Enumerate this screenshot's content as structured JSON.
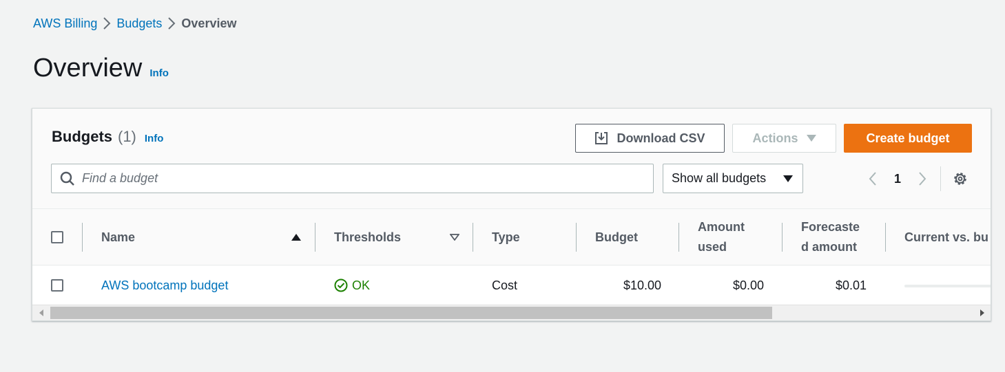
{
  "breadcrumb": {
    "items": [
      {
        "label": "AWS Billing"
      },
      {
        "label": "Budgets"
      },
      {
        "label": "Overview"
      }
    ]
  },
  "page": {
    "title": "Overview",
    "info_label": "Info"
  },
  "budgets_panel": {
    "title": "Budgets",
    "count": "(1)",
    "info_label": "Info",
    "download_csv_label": "Download CSV",
    "actions_label": "Actions",
    "create_budget_label": "Create budget",
    "search_placeholder": "Find a budget",
    "filter_selected": "Show all budgets",
    "current_page": "1"
  },
  "table": {
    "columns": {
      "name": "Name",
      "thresholds": "Thresholds",
      "type": "Type",
      "budget": "Budget",
      "amount_used_line1": "Amount",
      "amount_used_line2": "used",
      "forecasted_line1": "Forecaste",
      "forecasted_line2": "d amount",
      "current_vs_budgeted": "Current vs. bu"
    },
    "rows": [
      {
        "name": "AWS bootcamp budget",
        "thresholds": "OK",
        "type": "Cost",
        "budget": "$10.00",
        "amount_used": "$0.00",
        "forecasted_amount": "$0.01",
        "current_vs_budgeted_fraction": 0
      }
    ]
  },
  "icons": {
    "breadcrumb_separator": "chevron-right-icon",
    "download": "download-icon",
    "actions_caret": "caret-down-icon",
    "search": "search-icon",
    "filter_caret": "caret-down-icon",
    "prev_page": "chevron-left-icon",
    "next_page": "chevron-right-icon",
    "settings": "gear-icon",
    "sort_asc": "sort-ascending-icon",
    "sort_desc": "sort-descending-icon",
    "status_ok": "check-circle-icon"
  },
  "colors": {
    "link": "#0073bb",
    "primary_button": "#ec7211",
    "status_ok": "#1d8102",
    "background": "#f2f3f3"
  }
}
